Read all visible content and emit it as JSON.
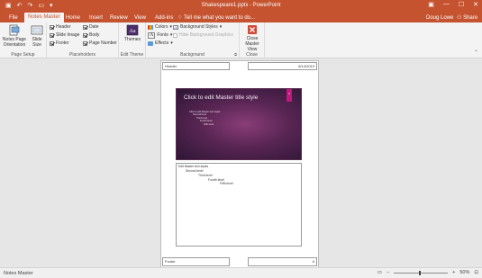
{
  "titlebar": {
    "title": "Shakespeare1.pptx - PowerPoint",
    "qat": [
      {
        "name": "save-icon",
        "glyph": "▣"
      },
      {
        "name": "undo-icon",
        "glyph": "↶"
      },
      {
        "name": "redo-icon",
        "glyph": "↷"
      },
      {
        "name": "slideshow-icon",
        "glyph": "▭"
      },
      {
        "name": "customize-qat-icon",
        "glyph": "▾"
      }
    ],
    "win_controls": {
      "ribbon_display": "▣",
      "minimize": "—",
      "maximize": "☐",
      "close": "✕"
    }
  },
  "tabs": [
    {
      "label": "File",
      "active": false
    },
    {
      "label": "Notes Master",
      "active": true
    },
    {
      "label": "Home",
      "active": false
    },
    {
      "label": "Insert",
      "active": false
    },
    {
      "label": "Review",
      "active": false
    },
    {
      "label": "View",
      "active": false
    },
    {
      "label": "Add-ins",
      "active": false
    }
  ],
  "tell_me": "Tell me what you want to do...",
  "user": "Doug Lowe",
  "share": "Share",
  "ribbon": {
    "page_setup": {
      "label": "Page Setup",
      "orientation": "Notes Page Orientation",
      "slide_size": "Slide Size"
    },
    "placeholders": {
      "label": "Placeholders",
      "items": [
        {
          "label": "Header",
          "checked": true
        },
        {
          "label": "Slide Image",
          "checked": true
        },
        {
          "label": "Footer",
          "checked": true
        },
        {
          "label": "Date",
          "checked": true
        },
        {
          "label": "Body",
          "checked": true
        },
        {
          "label": "Page Number",
          "checked": true
        }
      ]
    },
    "edit_theme": {
      "label": "Edit Theme",
      "themes": "Themes",
      "theme_thumb_text": "Aa"
    },
    "background": {
      "label": "Background",
      "colors": "Colors",
      "fonts": "Fonts",
      "effects": "Effects",
      "bg_styles": "Background Styles",
      "hide_bg": "Hide Background Graphics"
    },
    "close": {
      "label": "Close",
      "button": "Close Master View"
    }
  },
  "page": {
    "header": "Header",
    "date": "6/14/2019",
    "footer": "Footer",
    "page_number": "#",
    "slide": {
      "title": "Click to edit Master title style",
      "accent": "#",
      "body": [
        "Click to edit Master text styles",
        "Second level",
        "Third level",
        "Fourth level",
        "Fifth level"
      ]
    },
    "notes": [
      "Edit Master text styles",
      "Second level",
      "Third level",
      "Fourth level",
      "Fifth level"
    ]
  },
  "status": {
    "mode": "Notes Master",
    "zoom": "50%"
  },
  "colors": {
    "accent": "#c55330",
    "slide_accent": "#c2187a"
  }
}
